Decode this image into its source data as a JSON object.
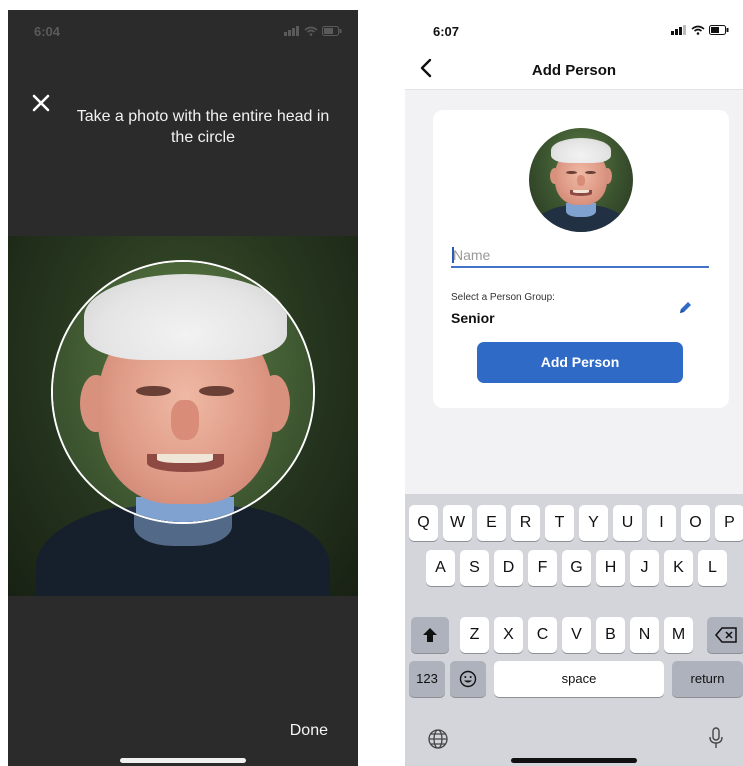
{
  "left_screen": {
    "status_time": "6:04",
    "close_icon": "close-icon",
    "instruction": "Take a photo with the entire head in the circle",
    "done_label": "Done"
  },
  "right_screen": {
    "status_time": "6:07",
    "nav_title": "Add Person",
    "name_placeholder": "Name",
    "name_value": "",
    "group_label": "Select a Person Group:",
    "group_value": "Senior",
    "add_button_label": "Add Person",
    "accent_color": "#2f6ac7"
  },
  "keyboard": {
    "row1": [
      "Q",
      "W",
      "E",
      "R",
      "T",
      "Y",
      "U",
      "I",
      "O",
      "P"
    ],
    "row2": [
      "A",
      "S",
      "D",
      "F",
      "G",
      "H",
      "J",
      "K",
      "L"
    ],
    "row3": [
      "Z",
      "X",
      "C",
      "V",
      "B",
      "N",
      "M"
    ],
    "numbers_key": "123",
    "space_key": "space",
    "return_key": "return"
  }
}
